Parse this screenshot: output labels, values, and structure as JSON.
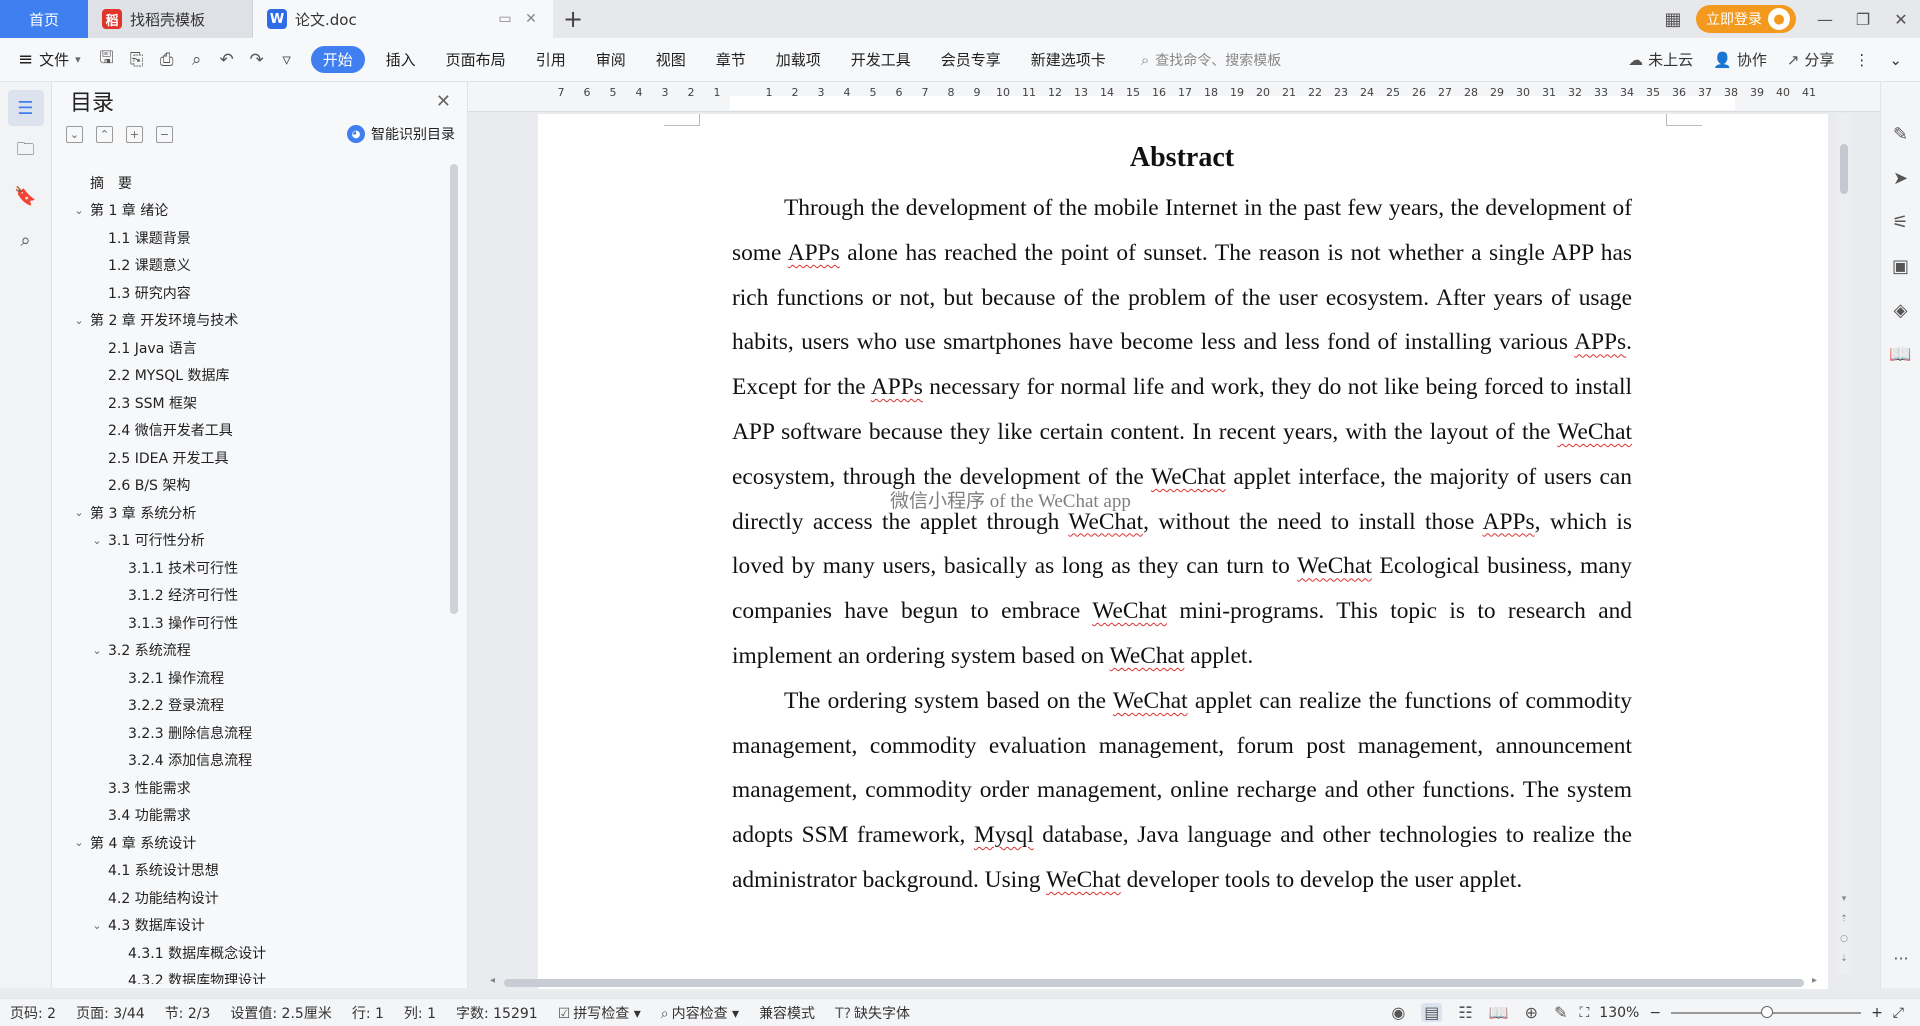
{
  "titlebar": {
    "home_tab": "首页",
    "tabs": [
      {
        "label": "找稻壳模板",
        "logo": "稻"
      },
      {
        "label": "论文.doc",
        "logo": "W"
      }
    ],
    "add_tab": "+",
    "login_label": "立即登录",
    "window_buttons": [
      "minimize-icon",
      "restore-icon",
      "close-icon"
    ]
  },
  "ribbon": {
    "file_label": "文件",
    "menu": [
      "开始",
      "插入",
      "页面布局",
      "引用",
      "审阅",
      "视图",
      "章节",
      "加载项",
      "开发工具",
      "会员专享",
      "新建选项卡"
    ],
    "active_menu": "开始",
    "search_placeholder": "查找命令、搜索模板",
    "right": {
      "cloud": "未上云",
      "collab": "协作",
      "share": "分享"
    }
  },
  "toc": {
    "title": "目录",
    "smart_label": "智能识别目录",
    "items": [
      {
        "label": "摘　要",
        "level": 1,
        "chevron": false
      },
      {
        "label": "第 1 章  绪论",
        "level": 1,
        "chevron": true
      },
      {
        "label": "1.1  课题背景",
        "level": 2,
        "chevron": false
      },
      {
        "label": "1.2  课题意义",
        "level": 2,
        "chevron": false
      },
      {
        "label": "1.3  研究内容",
        "level": 2,
        "chevron": false
      },
      {
        "label": "第 2 章  开发环境与技术",
        "level": 1,
        "chevron": true
      },
      {
        "label": "2.1 Java 语言",
        "level": 2,
        "chevron": false
      },
      {
        "label": "2.2 MYSQL 数据库",
        "level": 2,
        "chevron": false
      },
      {
        "label": "2.3 SSM 框架",
        "level": 2,
        "chevron": false
      },
      {
        "label": "2.4 微信开发者工具",
        "level": 2,
        "chevron": false
      },
      {
        "label": "2.5 IDEA 开发工具",
        "level": 2,
        "chevron": false
      },
      {
        "label": "2.6 B/S 架构",
        "level": 2,
        "chevron": false
      },
      {
        "label": "第 3 章  系统分析",
        "level": 1,
        "chevron": true
      },
      {
        "label": "3.1  可行性分析",
        "level": 2,
        "chevron": true
      },
      {
        "label": "3.1.1  技术可行性",
        "level": 3,
        "chevron": false
      },
      {
        "label": "3.1.2  经济可行性",
        "level": 3,
        "chevron": false
      },
      {
        "label": "3.1.3  操作可行性",
        "level": 3,
        "chevron": false
      },
      {
        "label": "3.2  系统流程",
        "level": 2,
        "chevron": true
      },
      {
        "label": "3.2.1  操作流程",
        "level": 3,
        "chevron": false
      },
      {
        "label": "3.2.2  登录流程",
        "level": 3,
        "chevron": false
      },
      {
        "label": "3.2.3  删除信息流程",
        "level": 3,
        "chevron": false
      },
      {
        "label": "3.2.4  添加信息流程",
        "level": 3,
        "chevron": false
      },
      {
        "label": "3.3  性能需求",
        "level": 2,
        "chevron": false
      },
      {
        "label": "3.4  功能需求",
        "level": 2,
        "chevron": false
      },
      {
        "label": "第 4 章  系统设计",
        "level": 1,
        "chevron": true
      },
      {
        "label": "4.1  系统设计思想",
        "level": 2,
        "chevron": false
      },
      {
        "label": "4.2  功能结构设计",
        "level": 2,
        "chevron": false
      },
      {
        "label": "4.3  数据库设计",
        "level": 2,
        "chevron": true
      },
      {
        "label": "4.3.1  数据库概念设计",
        "level": 3,
        "chevron": false
      },
      {
        "label": "4.3.2  数据库物理设计",
        "level": 3,
        "chevron": false
      }
    ]
  },
  "ruler": {
    "numbers": [
      "7",
      "6",
      "5",
      "4",
      "3",
      "2",
      "1",
      "",
      "1",
      "2",
      "3",
      "4",
      "5",
      "6",
      "7",
      "8",
      "9",
      "10",
      "11",
      "12",
      "13",
      "14",
      "15",
      "16",
      "17",
      "18",
      "19",
      "20",
      "21",
      "22",
      "23",
      "24",
      "25",
      "26",
      "27",
      "28",
      "29",
      "30",
      "31",
      "32",
      "33",
      "34",
      "35",
      "36",
      "37",
      "38",
      "39",
      "40",
      "41"
    ]
  },
  "document": {
    "title": "Abstract",
    "overlay_caption": "微信小程序 of the WeChat app",
    "paragraphs": [
      [
        {
          "t": "Through the development of the mobile Internet in the past few years, the development of some "
        },
        {
          "t": "APPs",
          "w": true
        },
        {
          "t": " alone has reached the point of sunset. The reason is not whether a single APP has rich functions or not, but because of the problem of the user ecosystem. After years of usage habits, users who use smartphones have become less and less fond of installing various "
        },
        {
          "t": "APPs",
          "w": true
        },
        {
          "t": ". Except for the "
        },
        {
          "t": "APPs",
          "w": true
        },
        {
          "t": " necessary for normal life and work, they do not like being forced to install APP software because they like certain content. In recent years, with the layout of the "
        },
        {
          "t": "WeChat",
          "w": true
        },
        {
          "t": " ecosystem, through the development of the "
        },
        {
          "t": "WeChat",
          "w": true
        },
        {
          "t": " applet interface, the majority of users can directly access the applet through "
        },
        {
          "t": "WeChat",
          "w": true
        },
        {
          "t": ", without the need to install those "
        },
        {
          "t": "APPs",
          "w": true
        },
        {
          "t": ", which is loved by many users, basically as long as they can turn to "
        },
        {
          "t": "WeChat",
          "w": true
        },
        {
          "t": " Ecological business, many companies have begun to embrace "
        },
        {
          "t": "WeChat",
          "w": true
        },
        {
          "t": " mini-programs. This topic is to research and implement an ordering system based on "
        },
        {
          "t": "WeChat",
          "w": true
        },
        {
          "t": " applet."
        }
      ],
      [
        {
          "t": "The ordering system based on the "
        },
        {
          "t": "WeChat",
          "w": true
        },
        {
          "t": " applet can realize the functions of commodity management, commodity evaluation management, forum post management, announcement management, commodity order management, online recharge and other functions. The system adopts SSM framework, "
        },
        {
          "t": "Mysql",
          "w": true
        },
        {
          "t": " database, Java language and other technologies to realize the administrator background. Using "
        },
        {
          "t": "WeChat",
          "w": true
        },
        {
          "t": " developer tools to develop the user applet."
        }
      ]
    ]
  },
  "statusbar": {
    "page_code": "页码: 2",
    "pages": "页面: 3/44",
    "section": "节: 2/3",
    "setting": "设置值: 2.5厘米",
    "row": "行: 1",
    "col": "列: 1",
    "words": "字数: 15291",
    "spell": "拼写检查",
    "content_check": "内容检查",
    "compat": "兼容模式",
    "missing_font": "缺失字体",
    "zoom": "130%"
  },
  "colors": {
    "accent": "#3f7ff0",
    "login": "#f39a1e",
    "spell_underline": "#dd3333"
  }
}
